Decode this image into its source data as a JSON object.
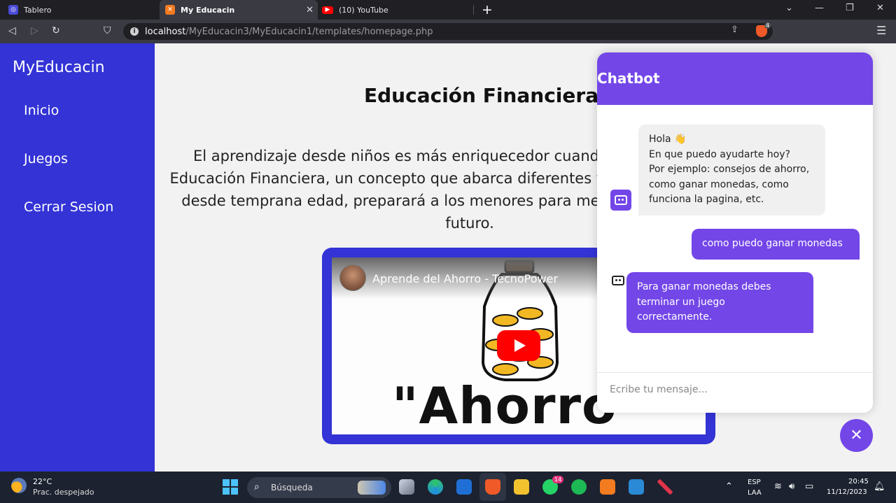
{
  "browser": {
    "tabs": [
      {
        "title": "Tablero",
        "icon": "app-icon"
      },
      {
        "title": "My Educacin",
        "icon": "xampp-icon",
        "active": true
      },
      {
        "title": "(10) YouTube",
        "icon": "youtube-icon"
      }
    ],
    "url_host": "localhost",
    "url_path": "/MyEducacin3/MyEducacin1/templates/homepage.php",
    "brave_badge": "4"
  },
  "sidebar": {
    "brand": "MyEducacin",
    "items": [
      {
        "label": "Inicio"
      },
      {
        "label": "Juegos"
      },
      {
        "label": "Cerrar Sesion"
      }
    ]
  },
  "main": {
    "title": "Educación Financiera",
    "intro": "El aprendizaje desde niños es más enriquecedor cuando se combina con la Educación Financiera, un concepto que abarca diferentes temas y si es enseñado desde temprana edad, preparará a los menores para mejores decisiones en el futuro.",
    "video": {
      "title": "Aprende del Ahorro - TecnoPower",
      "caption": "\"Ahorro"
    }
  },
  "chatbot": {
    "title": "Chatbot",
    "messages": [
      {
        "from": "bot",
        "lines": [
          "Hola 👋",
          "En que puedo ayudarte hoy?",
          "Por ejemplo: consejos de ahorro, como ganar monedas, como funciona la pagina, etc."
        ]
      },
      {
        "from": "user",
        "text": "como puedo ganar monedas"
      },
      {
        "from": "bot",
        "text": "Para ganar monedas debes terminar un juego correctamente."
      }
    ],
    "input_placeholder": "Ecribe tu mensaje...",
    "toggle_icon": "close-icon",
    "accent": "#7346e8"
  },
  "taskbar": {
    "temperature": "22°C",
    "weather": "Prac. despejado",
    "search_label": "Búsqueda",
    "whatsapp_badge": "14",
    "language": "ESP",
    "keyboard": "LAA",
    "time": "20:45",
    "date": "11/12/2023"
  },
  "colors": {
    "sidebar": "#3333d6",
    "chat_accent": "#7346e8",
    "background": "#f2f2f2"
  }
}
